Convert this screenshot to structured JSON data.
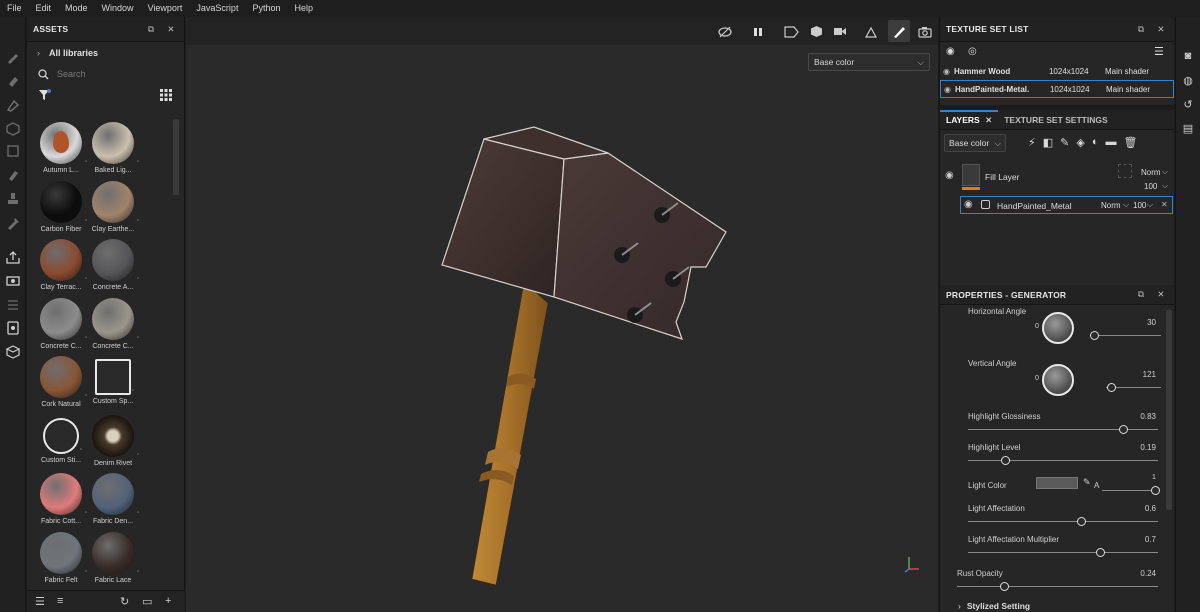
{
  "menu": [
    "File",
    "Edit",
    "Mode",
    "Window",
    "Viewport",
    "JavaScript",
    "Python",
    "Help"
  ],
  "assets": {
    "title": "ASSETS",
    "library": "All libraries",
    "search_placeholder": "Search",
    "items": [
      {
        "label": "Autumn L...",
        "color": "#d9d9d9",
        "kind": "leaf"
      },
      {
        "label": "Baked Lig...",
        "color": "#cbbfae"
      },
      {
        "label": "Carbon Fiber",
        "color": "#0c0c0c"
      },
      {
        "label": "Clay Earthe...",
        "color": "#a0846a"
      },
      {
        "label": "Clay Terrac...",
        "color": "#8c4a30"
      },
      {
        "label": "Concrete A...",
        "color": "#555558"
      },
      {
        "label": "Concrete C...",
        "color": "#8c8c8c"
      },
      {
        "label": "Concrete C...",
        "color": "#9a968c"
      },
      {
        "label": "Cork Natural",
        "color": "#8a5535"
      },
      {
        "label": "Custom Sp...",
        "color": "#2a2a2a",
        "kind": "spray"
      },
      {
        "label": "Custom Sti...",
        "color": "#2a2a2a",
        "kind": "smiley"
      },
      {
        "label": "Denim Rivet",
        "color": "#4a3a2a",
        "kind": "rivet"
      },
      {
        "label": "Fabric Cott...",
        "color": "#e07a7a"
      },
      {
        "label": "Fabric Den...",
        "color": "#53627a"
      },
      {
        "label": "Fabric Felt",
        "color": "#6f757c"
      },
      {
        "label": "Fabric Lace",
        "color": "#3a2d2a"
      }
    ]
  },
  "viewport": {
    "channel": "Base color"
  },
  "texture_set_list": {
    "title": "TEXTURE SET LIST",
    "rows": [
      {
        "name": "Hammer Wood",
        "res": "1024x1024",
        "shader": "Main shader"
      },
      {
        "name": "HandPainted-Metal.",
        "res": "1024x1024",
        "shader": "Main shader"
      }
    ]
  },
  "layers": {
    "tab_layers": "LAYERS",
    "tab_settings": "TEXTURE SET SETTINGS",
    "channel": "Base color",
    "fill_layer": {
      "name": "Fill Layer",
      "blend": "Norm",
      "opacity": "100"
    },
    "generator": {
      "name": "HandPainted_Metal",
      "blend": "Norm",
      "opacity": "100"
    }
  },
  "properties": {
    "title": "PROPERTIES - GENERATOR",
    "horizontal_angle": {
      "label": "Horizontal Angle",
      "value": "30",
      "dial_zero": "0",
      "fraction": 0.05
    },
    "vertical_angle": {
      "label": "Vertical Angle",
      "value": "121",
      "dial_zero": "0",
      "fraction": 0.1
    },
    "highlight_glossiness": {
      "label": "Highlight Glossiness",
      "value": "0.83",
      "fraction": 0.82
    },
    "highlight_level": {
      "label": "Highlight Level",
      "value": "0.19",
      "fraction": 0.2
    },
    "light_color": {
      "label": "Light Color",
      "swatch": "#5a5a5a",
      "alpha_label": "A",
      "alpha": "1",
      "fraction": 1.0
    },
    "light_affectation": {
      "label": "Light Affectation",
      "value": "0.6",
      "fraction": 0.6
    },
    "light_affectation_multiplier": {
      "label": "Light Affectation Multiplier",
      "value": "0.7",
      "fraction": 0.7
    },
    "rust_opacity": {
      "label": "Rust Opacity",
      "value": "0.24",
      "fraction": 0.24
    },
    "stylized_setting": "Stylized Setting"
  }
}
